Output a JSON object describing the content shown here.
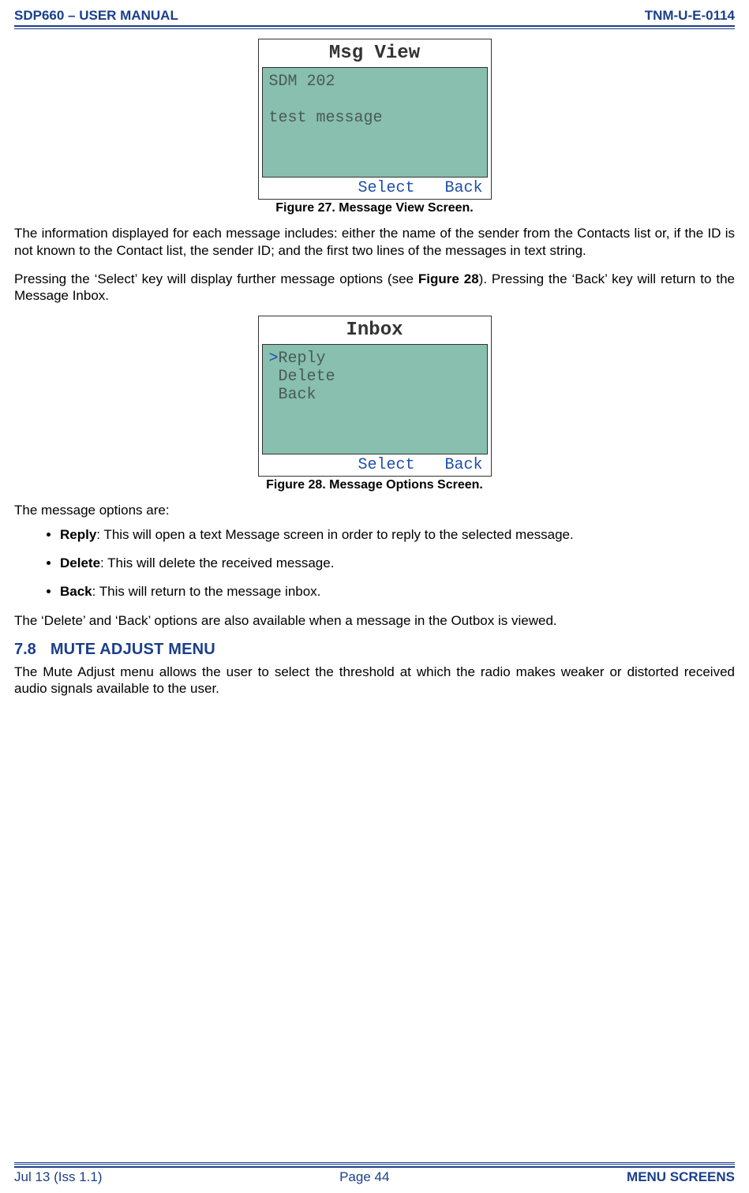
{
  "header": {
    "left": "SDP660 – USER MANUAL",
    "right": "TNM-U-E-0114"
  },
  "footer": {
    "left": "Jul 13 (Iss 1.1)",
    "center": "Page 44",
    "right": "MENU SCREENS"
  },
  "fig27": {
    "title": "Msg View",
    "line1": "SDM 202",
    "blank": " ",
    "line2": "test message",
    "softkey_left": "Select",
    "softkey_right": "Back",
    "caption": "Figure 27.  Message View Screen."
  },
  "para1": "The information displayed for each message includes: either the name of the sender from the Contacts list or, if the ID is not known to the Contact list, the sender ID; and the first two lines of the messages in text string.",
  "para2_a": "Pressing the ‘Select’ key will display further message options (see ",
  "para2_bold": "Figure 28",
  "para2_b": ").  Pressing the ‘Back’ key will return to the Message Inbox.",
  "fig28": {
    "title": "Inbox",
    "cursor": ">",
    "line1": "Reply",
    "line2": " Delete",
    "line3": " Back",
    "softkey_left": "Select",
    "softkey_right": "Back",
    "caption": "Figure 28.  Message Options Screen."
  },
  "para3": "The message options are:",
  "options": [
    {
      "lead": "Reply",
      "rest": ":  This will open a text Message screen in order to reply to the selected message."
    },
    {
      "lead": "Delete",
      "rest": ":  This will delete the received message."
    },
    {
      "lead": "Back",
      "rest": ":  This will return to the message inbox."
    }
  ],
  "para4": "The ‘Delete’ and ‘Back’ options are also available when a message in the Outbox is viewed.",
  "section": {
    "num": "7.8",
    "title_word1": "M",
    "title_rest1": "UTE ",
    "title_word2": "A",
    "title_rest2": "DJUST ",
    "title_word3": "M",
    "title_rest3": "ENU"
  },
  "section_title_plain": "MUTE ADJUST MENU",
  "para5": "The Mute Adjust menu allows the user to select the threshold at which the radio makes weaker or distorted received audio signals available to the user."
}
